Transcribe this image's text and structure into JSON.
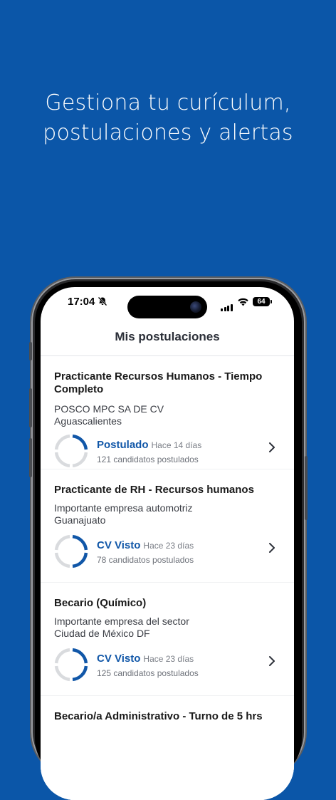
{
  "headline": {
    "line1": "Gestiona tu curículum,",
    "line2": "postulaciones y alertas"
  },
  "status_bar": {
    "time": "17:04",
    "battery": "64",
    "icons": [
      "bell-slash-icon",
      "signal-icon",
      "wifi-icon",
      "battery-icon"
    ]
  },
  "screen": {
    "title": "Mis postulaciones"
  },
  "applications": [
    {
      "title": "Practicante Recursos Humanos - Tiempo Completo",
      "company": "POSCO MPC SA DE CV",
      "location": "Aguascalientes",
      "status": "Postulado",
      "ago": "Hace 14 días",
      "candidates": "121 candidatos postulados",
      "progress_segments_filled": 1
    },
    {
      "title": "Practicante de RH - Recursos humanos",
      "company": "Importante empresa automotriz",
      "location": "Guanajuato",
      "status": "CV Visto",
      "ago": "Hace 23 días",
      "candidates": "78 candidatos postulados",
      "progress_segments_filled": 2
    },
    {
      "title": "Becario (Químico)",
      "company": "Importante empresa del sector",
      "location": "Ciudad de México DF",
      "status": "CV Visto",
      "ago": "Hace 23 días",
      "candidates": "125 candidatos postulados",
      "progress_segments_filled": 2
    },
    {
      "title": "Becario/a Administrativo - Turno de 5 hrs"
    }
  ],
  "colors": {
    "background": "#0b56a8",
    "accent": "#1157a8",
    "ring_inactive": "#d9dbde"
  }
}
